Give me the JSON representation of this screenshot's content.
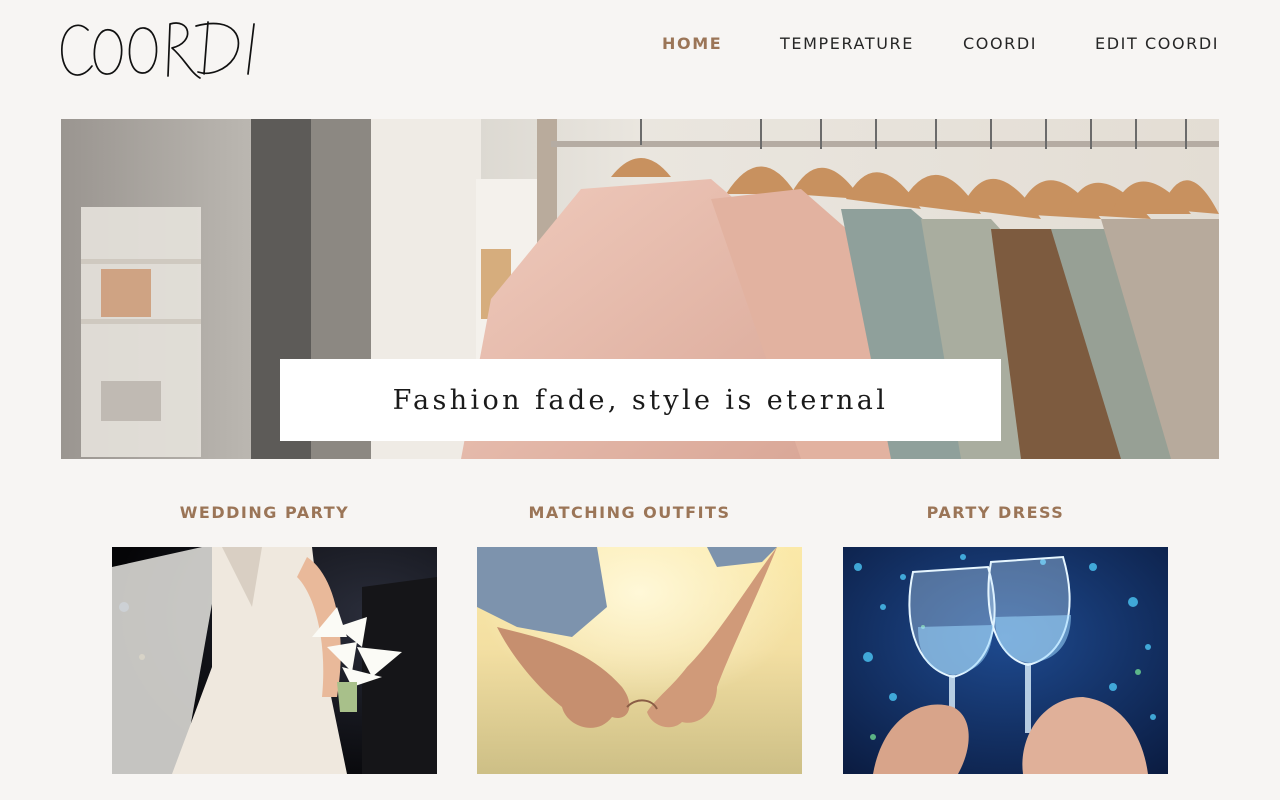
{
  "brand": {
    "logo_text": "COORDI"
  },
  "nav": {
    "items": [
      {
        "label": "HOME",
        "active": true
      },
      {
        "label": "TEMPERATURE",
        "active": false
      },
      {
        "label": "COORDI",
        "active": false
      },
      {
        "label": "EDIT COORDI",
        "active": false
      }
    ]
  },
  "hero": {
    "caption": "Fashion fade, style is eternal",
    "image": "clothes-rack-photo"
  },
  "categories": [
    {
      "title": "WEDDING PARTY",
      "image": "bride-bouquet-photo"
    },
    {
      "title": "MATCHING OUTFITS",
      "image": "pinky-promise-photo"
    },
    {
      "title": "PARTY DRESS",
      "image": "champagne-toast-photo"
    }
  ],
  "colors": {
    "accent": "#9b7557",
    "background": "#f7f5f3"
  }
}
